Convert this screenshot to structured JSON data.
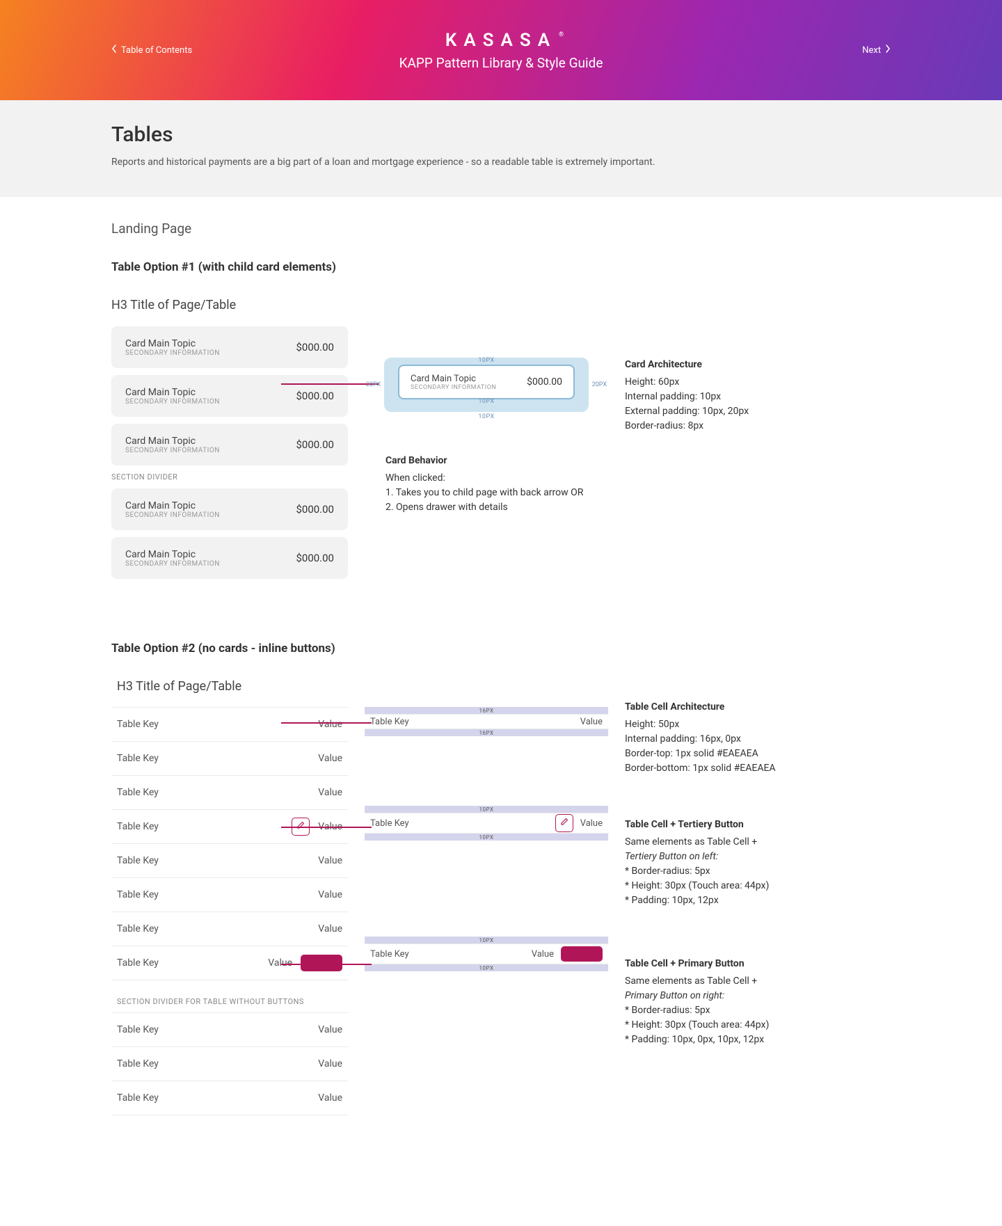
{
  "header": {
    "toc": "Table of Contents",
    "next": "Next",
    "logo": "KASASA",
    "reg": "®",
    "subtitle": "KAPP Pattern Library & Style Guide"
  },
  "intro": {
    "title": "Tables",
    "desc": "Reports and historical payments are a big part of a loan and mortgage experience - so a readable table is extremely important."
  },
  "landing": {
    "title": "Landing Page"
  },
  "opt1": {
    "title": "Table Option  #1 (with child card elements)",
    "h3": "H3 Title of Page/Table",
    "card_main": "Card Main Topic",
    "card_sub": "SECONDARY INFORMATION",
    "card_value": "$000.00",
    "divider": "SECTION DIVIDER",
    "px10": "10PX",
    "px20": "20PX",
    "arch_title": "Card Architecture",
    "arch_l1": "Height: 60px",
    "arch_l2": "Internal padding: 10px",
    "arch_l3": "External padding: 10px, 20px",
    "arch_l4": "Border-radius: 8px",
    "behav_title": "Card Behavior",
    "behav_l1": "When clicked:",
    "behav_l2": "1. Takes you to child page with back arrow OR",
    "behav_l3": "2. Opens drawer with details"
  },
  "opt2": {
    "title": "Table Option  #2 (no cards - inline buttons)",
    "h3": "H3 Title of Page/Table",
    "key": "Table Key",
    "value": "Value",
    "divider": "SECTION DIVIDER FOR TABLE WITHOUT BUTTONS",
    "px16": "16PX",
    "px10": "10PX",
    "arch_title": "Table Cell Architecture",
    "arch_l1": "Height: 50px",
    "arch_l2": "Internal padding: 16px, 0px",
    "arch_l3": "Border-top: 1px solid #EAEAEA",
    "arch_l4": "Border-bottom: 1px solid #EAEAEA",
    "tert_title": "Table Cell + Tertiery Button",
    "tert_l1": "Same elements as Table Cell +",
    "tert_l2": "Tertiery Button on left:",
    "tert_l3": "* Border-radius: 5px",
    "tert_l4": "* Height: 30px (Touch area: 44px)",
    "tert_l5": "* Padding: 10px, 12px",
    "prim_title": "Table Cell + Primary Button",
    "prim_l1": "Same elements as Table Cell +",
    "prim_l2": "Primary Button on right:",
    "prim_l3": "* Border-radius: 5px",
    "prim_l4": "* Height: 30px (Touch area: 44px)",
    "prim_l5": "* Padding: 10px, 0px, 10px, 12px"
  }
}
